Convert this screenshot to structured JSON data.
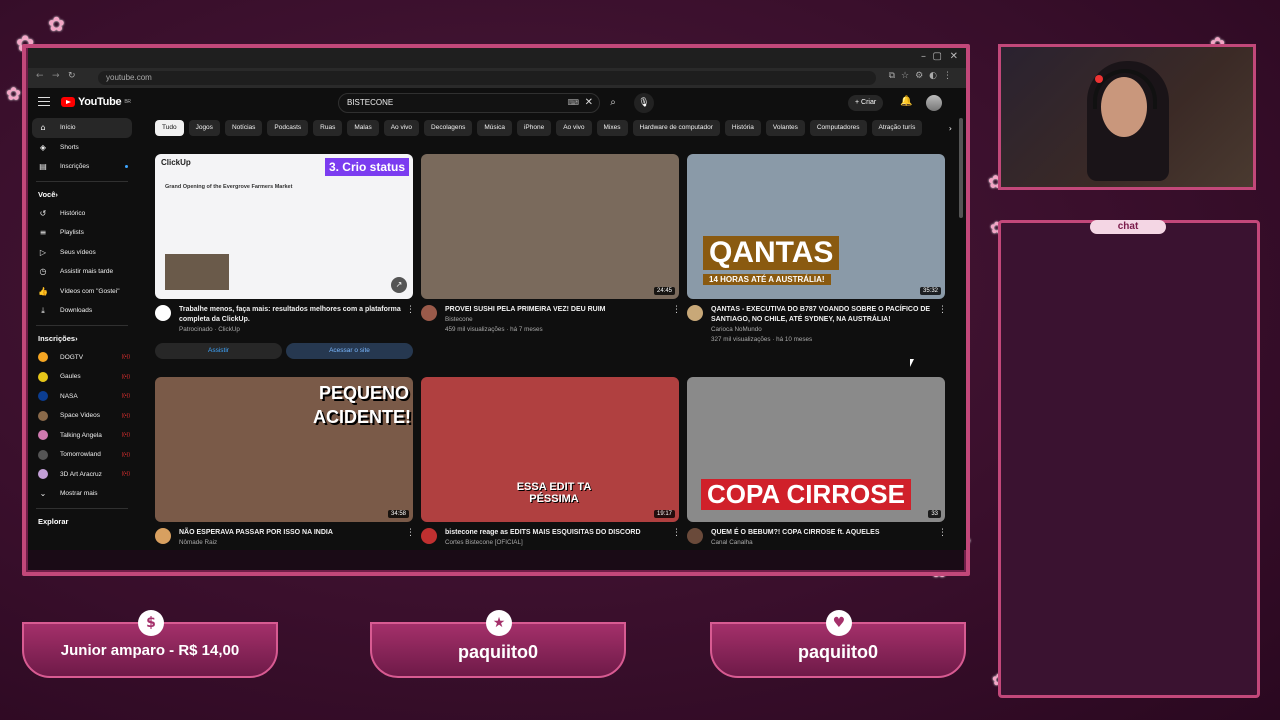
{
  "browser": {
    "url": "youtube.com",
    "window_controls": [
      "–",
      "▢",
      "✕"
    ]
  },
  "youtube": {
    "logo_text": "YouTube",
    "logo_country": "BR",
    "search_value": "BISTECONE",
    "create_label": "Criar",
    "chips": [
      "Tudo",
      "Jogos",
      "Notícias",
      "Podcasts",
      "Ruas",
      "Malas",
      "Ao vivo",
      "Decolagens",
      "Música",
      "iPhone",
      "Ao vivo",
      "Mixes",
      "Hardware de computador",
      "História",
      "Volantes",
      "Computadores",
      "Atração turís"
    ],
    "sidebar": {
      "main": [
        {
          "icon": "home-icon",
          "glyph": "⌂",
          "label": "Início"
        },
        {
          "icon": "shorts-icon",
          "glyph": "◈",
          "label": "Shorts"
        },
        {
          "icon": "subscriptions-icon",
          "glyph": "▤",
          "label": "Inscrições"
        }
      ],
      "you_heading": "Você",
      "you": [
        {
          "icon": "history-icon",
          "glyph": "↺",
          "label": "Histórico"
        },
        {
          "icon": "playlists-icon",
          "glyph": "≡",
          "label": "Playlists"
        },
        {
          "icon": "your-videos-icon",
          "glyph": "▷",
          "label": "Seus vídeos"
        },
        {
          "icon": "watch-later-icon",
          "glyph": "◷",
          "label": "Assistir mais tarde"
        },
        {
          "icon": "liked-icon",
          "glyph": "👍",
          "label": "Vídeos com \"Gostei\""
        },
        {
          "icon": "downloads-icon",
          "glyph": "⤓",
          "label": "Downloads"
        }
      ],
      "subs_heading": "Inscrições",
      "subs": [
        {
          "label": "DOGTV",
          "color": "#f5a623"
        },
        {
          "label": "Gaules",
          "color": "#e6c619"
        },
        {
          "label": "NASA",
          "color": "#0b3d91"
        },
        {
          "label": "Space Videos",
          "color": "#8a6a4a"
        },
        {
          "label": "Talking Angela",
          "color": "#d07ab0"
        },
        {
          "label": "Tomorrowland",
          "color": "#555555"
        },
        {
          "label": "3D Art Aracruz",
          "color": "#c4a0d8"
        }
      ],
      "show_more": "Mostrar mais",
      "explore_heading": "Explorar"
    },
    "videos": [
      {
        "title": "Trabalhe menos, faça mais: resultados melhores com a plataforma completa da ClickUp.",
        "line1": "Patrocinado · ClickUp",
        "line2": "",
        "duration": "",
        "thumb_text": "3. Crio status",
        "thumb_brand": "ClickUp",
        "thumb_heading": "Grand Opening of the Evergrove Farmers Market",
        "ad_buttons": [
          "Assistir",
          "Acessar o site"
        ],
        "avatar_color": "#ffffff",
        "thumb_bg": "#f4f4f6"
      },
      {
        "title": "PROVEI SUSHI PELA PRIMEIRA VEZ! DEU RUIM",
        "line1": "Bistecone",
        "line2": "459 mil visualizações · há 7 meses",
        "duration": "24:45",
        "avatar_color": "#9a5a4a",
        "thumb_bg": "#7a6a5c"
      },
      {
        "title": "QANTAS - EXECUTIVA DO B787 VOANDO SOBRE O PACÍFICO DE SANTIAGO, NO CHILE, ATÉ SYDNEY, NA AUSTRÁLIA!",
        "line1": "Carioca NoMundo",
        "line2": "327 mil visualizações · há 10 meses",
        "duration": "35:32",
        "thumb_text": "QANTAS",
        "thumb_sub": "14 HORAS ATÉ A AUSTRÁLIA!",
        "avatar_color": "#c8a878",
        "thumb_bg": "#8a9aa8"
      },
      {
        "title": "NÃO ESPERAVA PASSAR POR ISSO NA INDIA",
        "line1": "Nômade Raiz",
        "line2": "",
        "duration": "34:58",
        "thumb_text": "PEQUENO ACIDENTE!",
        "avatar_color": "#d8a060",
        "thumb_bg": "#7a5a48"
      },
      {
        "title": "bistecone reage as EDITS MAIS ESQUISITAS DO DISCORD",
        "line1": "Cortes Bistecone [OFICIAL]",
        "line2": "",
        "duration": "19:17",
        "thumb_text": "ESSA EDIT TA PÉSSIMA",
        "avatar_color": "#c03030",
        "thumb_bg": "#b04040"
      },
      {
        "title": "QUEM É O BEBUM?! COPA CIRROSE ft. AQUELES",
        "line1": "Canal Canalha",
        "line2": "",
        "duration": "33",
        "thumb_text": "COPA CIRROSE",
        "avatar_color": "#6a4a3a",
        "thumb_bg": "#8a8a8a"
      }
    ]
  },
  "stream": {
    "chat_label": "chat",
    "alerts": [
      {
        "text": "Junior amparo - R$ 14,00",
        "icon": "dollar-icon",
        "glyph": "$"
      },
      {
        "text": "paquiito0",
        "icon": "star-icon",
        "glyph": "★"
      },
      {
        "text": "paquiito0",
        "icon": "heart-icon",
        "glyph": "♥"
      }
    ]
  },
  "colors": {
    "accent_pink": "#c2487a",
    "yt_red": "#ff0000",
    "yt_bg": "#0f0f0f"
  }
}
